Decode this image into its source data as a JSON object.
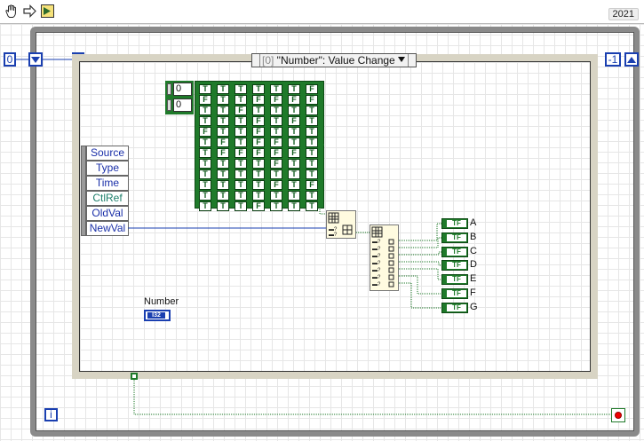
{
  "toolbar": {
    "run_icon": "hand-icon",
    "arrow_icon": "run-arrow-icon",
    "version": "2021"
  },
  "while_loop": {
    "left_tunnel_value": "0",
    "right_tunnel_value": "-1"
  },
  "event_structure": {
    "selector_index": "[0]",
    "selector_label": " \"Number\": Value Change",
    "event_data": [
      "Source",
      "Type",
      "Time",
      "CtlRef",
      "OldVal",
      "NewVal"
    ]
  },
  "array_constant": {
    "indices": [
      "0",
      "0"
    ],
    "rows": [
      [
        "T",
        "T",
        "T",
        "T",
        "T",
        "T",
        "F"
      ],
      [
        "F",
        "T",
        "T",
        "F",
        "F",
        "F",
        "F"
      ],
      [
        "T",
        "T",
        "F",
        "T",
        "T",
        "T",
        "T"
      ],
      [
        "T",
        "T",
        "T",
        "F",
        "T",
        "F",
        "T"
      ],
      [
        "F",
        "T",
        "T",
        "F",
        "T",
        "T",
        "T"
      ],
      [
        "T",
        "F",
        "T",
        "F",
        "F",
        "T",
        "T"
      ],
      [
        "T",
        "F",
        "F",
        "F",
        "F",
        "F",
        "T"
      ],
      [
        "T",
        "T",
        "T",
        "T",
        "F",
        "T",
        "T"
      ],
      [
        "T",
        "T",
        "T",
        "T",
        "T",
        "T",
        "T"
      ],
      [
        "T",
        "T",
        "T",
        "T",
        "F",
        "T",
        "F"
      ],
      [
        "T",
        "T",
        "T",
        "T",
        "T",
        "T",
        "T"
      ],
      [
        "T",
        "T",
        "T",
        "F",
        "T",
        "T",
        "T"
      ]
    ]
  },
  "control": {
    "label": "Number",
    "terminal_type": "I32"
  },
  "outputs": {
    "type_label": "TF",
    "labels": [
      "A",
      "B",
      "C",
      "D",
      "E",
      "F",
      "G"
    ]
  },
  "iteration_label": "i"
}
